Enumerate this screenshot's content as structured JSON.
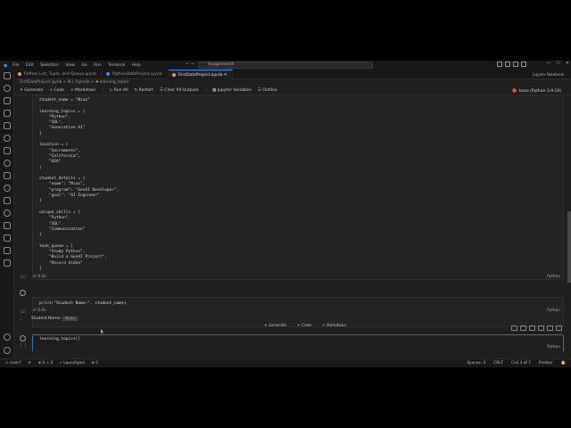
{
  "titlebar": {
    "menu": [
      "File",
      "Edit",
      "Selection",
      "View",
      "Go",
      "Run",
      "Terminal",
      "Help"
    ],
    "command_center": "Assignment4"
  },
  "tabs": [
    {
      "label": "Python List, Tuple, and Queue.ipynb",
      "color": "#e8a040",
      "active": false
    },
    {
      "label": "PythonDataProject.ipynb",
      "color": "#3b8eea",
      "active": false
    },
    {
      "label": "FirstDataProject.ipynb",
      "color": "#e8a040",
      "active": true
    }
  ],
  "tabs_right": "Jupyter Notebook",
  "breadcrumb": "FirstDataProject.ipynb > M↓ Agenda > ✚ learning_topics",
  "toolbar": {
    "items": [
      "✦ Generate",
      "+ Code",
      "+ Markdown",
      "▷ Run All",
      "↻ Restart",
      "☰ Clear All Outputs",
      "▦ Jupyter Variables",
      "☰ Outline"
    ],
    "kernel": "base (Python 3.9.19)"
  },
  "cells": {
    "cell1_code": "student_name = \"Niaz\"\n\nlearning_topics = [\n    \"Python\",\n    \"SQL\",\n    \"Generative AI\"\n]\n\nlocation = (\n    \"Sacramento\",\n    \"California\",\n    \"USA\"\n)\n\nstudent_details = {\n    \"name\": \"Niaz\",\n    \"program\": \"GenAI Developer\",\n    \"goal\": \"AI Engineer\"\n}\n\nunique_skills = {\n    \"Python\",\n    \"SQL\",\n    \"Communication\"\n}\n\ntask_queue = [\n    \"Study Python\",\n    \"Build a GenAI Project\",\n    \"Record Video\"\n]",
    "cell1_gutter": "[1]",
    "cell1_time": "0.0s",
    "cell1_lang": "Python",
    "cell2_code": "print(\"Student Name:\", student_name)",
    "cell2_gutter": "[2]",
    "cell2_time": "0.0s",
    "cell2_lang": "Python",
    "cell2_output_label": "Student Name:",
    "cell2_output_value": "Niaz",
    "cell3_code": "learning_topics[]",
    "cell3_gutter": "[ ]",
    "cell3_lang": "Python"
  },
  "add_cell_bar": [
    "✦ Generate",
    "+ Code",
    "+ Markdown"
  ],
  "status": {
    "left": [
      "⚠ main*",
      "⟳",
      "⊗ 0 ⚠ 0",
      "⚡ Launchpad",
      "⊗ 0"
    ],
    "right": [
      "Spaces: 4",
      "CRLF",
      "Cell 3 of 7",
      "Prettier",
      "🔔"
    ]
  },
  "colors": {
    "accent": "#3b8eea",
    "bg": "#1f1f1f",
    "chrome": "#181818",
    "string": "#ce9178"
  }
}
